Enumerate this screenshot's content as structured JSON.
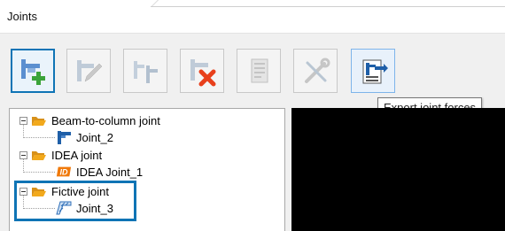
{
  "window": {
    "title": "Joints"
  },
  "toolbar": {
    "buttons": [
      {
        "name": "new-joint",
        "icon": "add-joint-icon",
        "state": "active"
      },
      {
        "name": "edit-joint",
        "icon": "edit-joint-icon",
        "state": "disabled"
      },
      {
        "name": "copy-joint",
        "icon": "copy-joint-icon",
        "state": "disabled"
      },
      {
        "name": "delete-joint",
        "icon": "delete-joint-icon",
        "state": "disabled"
      },
      {
        "name": "report",
        "icon": "report-icon",
        "state": "disabled"
      },
      {
        "name": "settings",
        "icon": "tools-icon",
        "state": "disabled"
      },
      {
        "name": "export-joint-forces",
        "icon": "export-forces-icon",
        "state": "hover"
      }
    ],
    "tooltip": "Export joint forces"
  },
  "tree": {
    "groups": [
      {
        "label": "Beam-to-column joint",
        "children": [
          {
            "label": "Joint_2"
          }
        ]
      },
      {
        "label": "IDEA joint",
        "children": [
          {
            "badge": "ID",
            "label": "IDEA Joint_1"
          }
        ]
      },
      {
        "label": "Fictive joint",
        "children": [
          {
            "label": "Joint_3"
          }
        ]
      }
    ]
  },
  "colors": {
    "accent": "#0f74b5",
    "folder": "#f2a91c",
    "joint": "#1f5fa8",
    "idea": "#f0790a",
    "delete": "#e8401c",
    "add": "#3aa33a"
  }
}
